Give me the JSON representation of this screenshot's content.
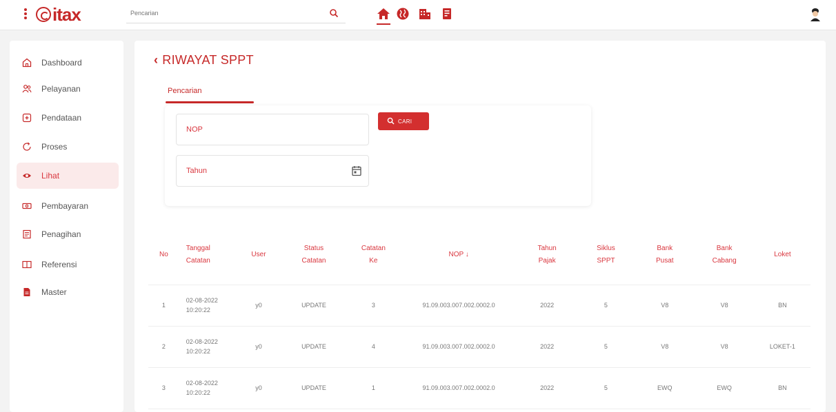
{
  "app": {
    "logo_text": "itax",
    "brand_color": "#c62828"
  },
  "search": {
    "placeholder": "Pencarian"
  },
  "nav_icons": [
    "home-icon",
    "globe-icon",
    "building-icon",
    "document-icon"
  ],
  "sidebar": {
    "items": [
      {
        "label": "Dashboard",
        "icon": "home-outline-icon"
      },
      {
        "label": "Pelayanan",
        "icon": "users-icon"
      },
      {
        "label": "Pendataan",
        "icon": "plus-box-icon"
      },
      {
        "label": "Proses",
        "icon": "circle-arrow-icon"
      },
      {
        "label": "Lihat",
        "icon": "eye-icon",
        "active": true
      },
      {
        "label": "Pembayaran",
        "icon": "cash-icon"
      },
      {
        "label": "Penagihan",
        "icon": "bill-icon"
      },
      {
        "label": "Referensi",
        "icon": "book-icon"
      },
      {
        "label": "Master",
        "icon": "file-icon"
      }
    ]
  },
  "main": {
    "title": "RIWAYAT SPPT",
    "tab_label": "Pencarian",
    "form": {
      "nop_placeholder": "NOP",
      "tahun_placeholder": "Tahun",
      "cari_label": "CARI"
    },
    "table": {
      "headers": [
        [
          "No"
        ],
        [
          "Tanggal",
          "Catatan"
        ],
        [
          "User"
        ],
        [
          "Status",
          "Catatan"
        ],
        [
          "Catatan",
          "Ke"
        ],
        [
          "NOP ↓"
        ],
        [
          "Tahun",
          "Pajak"
        ],
        [
          "Siklus",
          "SPPT"
        ],
        [
          "Bank",
          "Pusat"
        ],
        [
          "Bank",
          "Cabang"
        ],
        [
          "Loket"
        ]
      ],
      "rows": [
        {
          "no": "1",
          "date": "02-08-2022",
          "time": "10:20:22",
          "user": "y0",
          "status": "UPDATE",
          "catatan_ke": "3",
          "nop": "91.09.003.007.002.0002.0",
          "tahun": "2022",
          "siklus": "5",
          "bank_pusat": "V8",
          "bank_cabang": "V8",
          "loket": "BN"
        },
        {
          "no": "2",
          "date": "02-08-2022",
          "time": "10:20:22",
          "user": "y0",
          "status": "UPDATE",
          "catatan_ke": "4",
          "nop": "91.09.003.007.002.0002.0",
          "tahun": "2022",
          "siklus": "5",
          "bank_pusat": "V8",
          "bank_cabang": "V8",
          "loket": "LOKET-1"
        },
        {
          "no": "3",
          "date": "02-08-2022",
          "time": "10:20:22",
          "user": "y0",
          "status": "UPDATE",
          "catatan_ke": "1",
          "nop": "91.09.003.007.002.0002.0",
          "tahun": "2022",
          "siklus": "5",
          "bank_pusat": "EWQ",
          "bank_cabang": "EWQ",
          "loket": "BN"
        }
      ]
    }
  }
}
